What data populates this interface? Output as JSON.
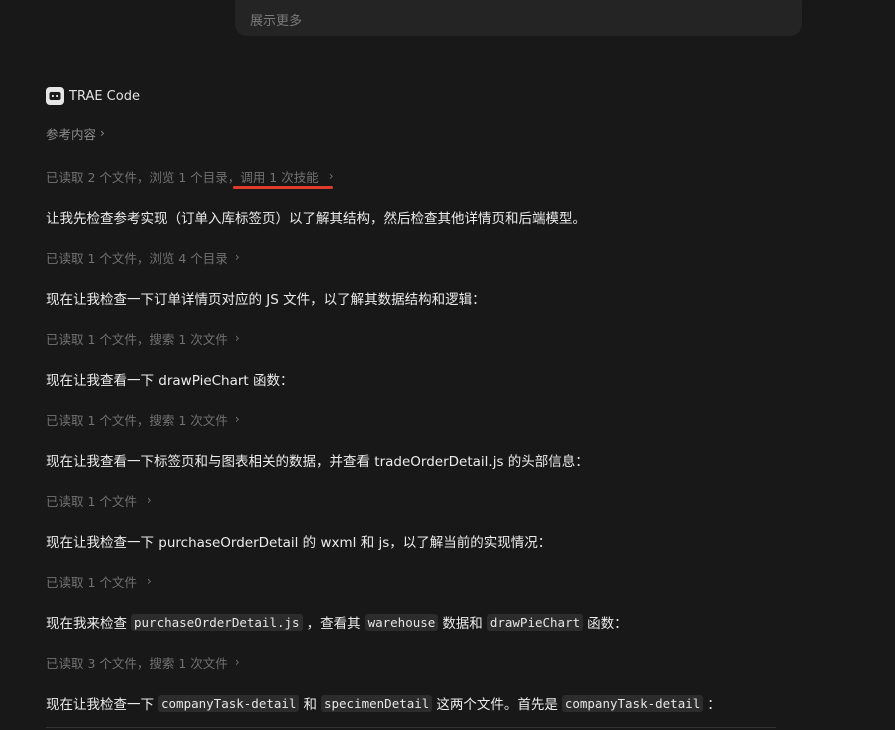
{
  "top_panel": {
    "expand_label": "展示更多"
  },
  "agent": {
    "name": "TRAE Code"
  },
  "reference": {
    "label": "参考内容",
    "chevron": "›"
  },
  "status_1": {
    "text_a": "已读取 2 个文件，浏览 1 个目录，",
    "text_b": "调用 1 次技能",
    "chevron": "›"
  },
  "message_1": {
    "text": "让我先检查参考实现（订单入库标签页）以了解其结构，然后检查其他详情页和后端模型。"
  },
  "status_2": {
    "text": "已读取 1 个文件，浏览 4 个目录",
    "chevron": "›"
  },
  "message_2": {
    "text": "现在让我检查一下订单详情页对应的 JS 文件，以了解其数据结构和逻辑："
  },
  "status_3": {
    "text": "已读取 1 个文件，搜索 1 次文件",
    "chevron": "›"
  },
  "message_3": {
    "text": "现在让我查看一下 drawPieChart 函数："
  },
  "status_4": {
    "text": "已读取 1 个文件，搜索 1 次文件",
    "chevron": "›"
  },
  "message_4": {
    "text": "现在让我查看一下标签页和与图表相关的数据，并查看 tradeOrderDetail.js 的头部信息："
  },
  "status_5": {
    "text": "已读取 1 个文件",
    "chevron": "›"
  },
  "message_5": {
    "text": "现在让我检查一下 purchaseOrderDetail 的 wxml 和 js，以了解当前的实现情况："
  },
  "status_6": {
    "text": "已读取 1 个文件",
    "chevron": "›"
  },
  "message_6": {
    "part1": "现在我来检查",
    "code1": "purchaseOrderDetail.js",
    "part2": "，查看其",
    "code2": "warehouse",
    "part3": "数据和",
    "code3": "drawPieChart",
    "part4": "函数："
  },
  "status_7": {
    "text": "已读取 3 个文件，搜索 1 次文件",
    "chevron": "›"
  },
  "message_7": {
    "part1": "现在让我检查一下",
    "code1": "companyTask-detail",
    "part2": "和",
    "code2": "specimenDetail",
    "part3": "这两个文件。首先是",
    "code3": "companyTask-detail",
    "part4": "："
  },
  "colors": {
    "background": "#181818",
    "panel": "#242424",
    "highlight_underline": "#e03a2a"
  }
}
